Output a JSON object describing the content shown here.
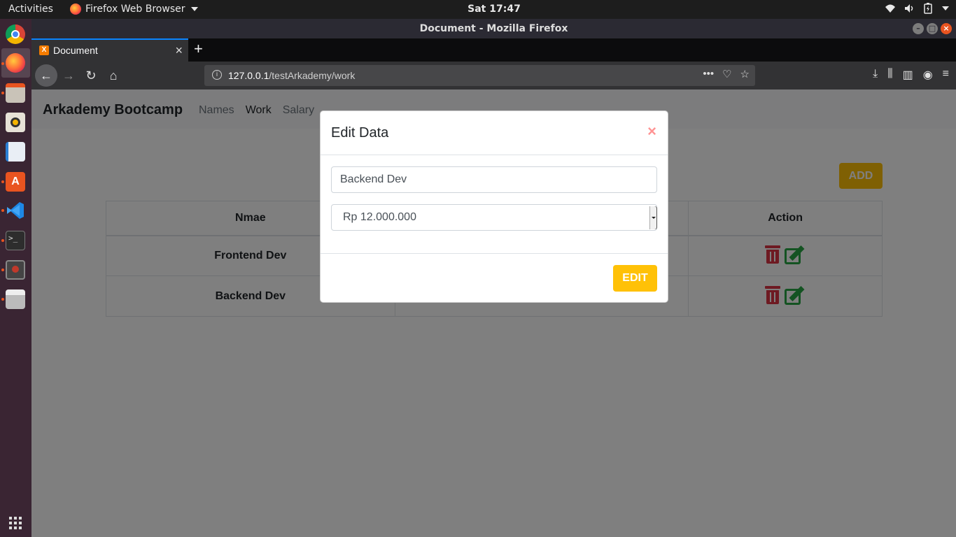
{
  "topbar": {
    "activities": "Activities",
    "app_menu": "Firefox Web Browser",
    "clock": "Sat 17:47"
  },
  "dock": {
    "items": [
      "chrome-icon",
      "firefox-icon",
      "files-icon",
      "rhythmbox-icon",
      "libreoffice-writer-icon",
      "software-center-icon",
      "vscode-icon",
      "terminal-icon",
      "screenshot-icon",
      "printer-icon"
    ]
  },
  "window": {
    "title": "Document - Mozilla Firefox"
  },
  "tab": {
    "label": "Document",
    "favicon": "X"
  },
  "urlbar": {
    "host": "127.0.0.1",
    "path": "/testArkademy/work"
  },
  "page": {
    "brand": "Arkademy Bootcamp",
    "nav": [
      "Names",
      "Work",
      "Salary"
    ],
    "add_label": "ADD",
    "table": {
      "headers": [
        "Nmae",
        "",
        "Action"
      ],
      "rows": [
        {
          "name": "Frontend Dev"
        },
        {
          "name": "Backend Dev"
        }
      ]
    }
  },
  "modal": {
    "title": "Edit Data",
    "close": "×",
    "name_value": "Backend Dev",
    "salary_value": "Rp 12.000.000",
    "edit_label": "EDIT"
  },
  "colors": {
    "accent_yellow": "#ffc107",
    "danger_red": "#dc3545",
    "success_green": "#28a745"
  }
}
